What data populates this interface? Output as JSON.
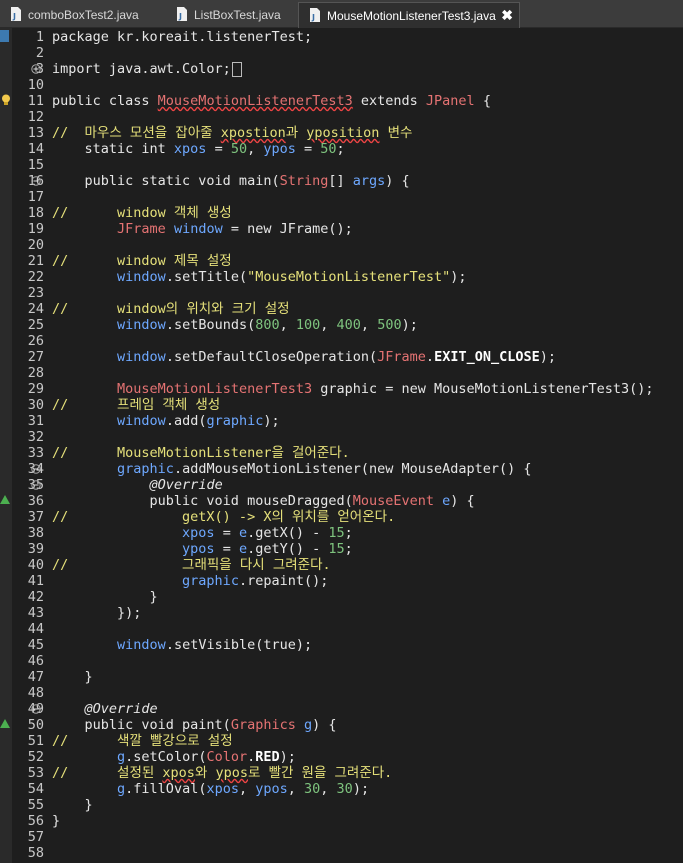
{
  "tabs": [
    {
      "label": "comboBoxTest2.java",
      "active": false
    },
    {
      "label": "ListBoxTest.java",
      "active": false
    },
    {
      "label": "MouseMotionListenerTest3.java",
      "active": true,
      "close": "✖"
    }
  ],
  "line_numbers": [
    "1",
    "2",
    "3",
    "10",
    "11",
    "12",
    "13",
    "14",
    "15",
    "16",
    "17",
    "18",
    "19",
    "20",
    "21",
    "22",
    "23",
    "24",
    "25",
    "26",
    "27",
    "28",
    "29",
    "30",
    "31",
    "32",
    "33",
    "34",
    "35",
    "36",
    "37",
    "38",
    "39",
    "40",
    "41",
    "42",
    "43",
    "44",
    "45",
    "46",
    "47",
    "48",
    "49",
    "50",
    "51",
    "52",
    "53",
    "54",
    "55",
    "56",
    "57",
    "58"
  ],
  "code": {
    "l1": {
      "a": "package kr.koreait.listenerTest;"
    },
    "l3": {
      "a": "import java.awt.Color;"
    },
    "l11": {
      "a": "public class ",
      "b": "MouseMotionListenerTest3",
      "c": " extends ",
      "d": "JPanel",
      "e": " {"
    },
    "l13": {
      "a": "//  마우스 모션을 잡아줄 ",
      "b": "xpostion",
      "c": "과 ",
      "d": "yposition",
      "e": " 변수"
    },
    "l14": {
      "a": "    static int ",
      "b": "xpos",
      "c": " = ",
      "d": "50",
      "e": ", ",
      "f": "ypos",
      "g": " = ",
      "h": "50",
      "i": ";"
    },
    "l16": {
      "a": "    public static void main(",
      "b": "String",
      "c": "[] ",
      "d": "args",
      "e": ") {"
    },
    "l18": {
      "a": "//      window 객체 생성"
    },
    "l19": {
      "a": "        ",
      "b": "JFrame",
      "c": " ",
      "d": "window",
      "e": " = new JFrame();"
    },
    "l21": {
      "a": "//      window 제목 설정"
    },
    "l22": {
      "a": "        ",
      "b": "window",
      "c": ".setTitle(",
      "d": "\"MouseMotionListenerTest\"",
      "e": ");"
    },
    "l24": {
      "a": "//      window의 위치와 크기 설정"
    },
    "l25": {
      "a": "        ",
      "b": "window",
      "c": ".setBounds(",
      "d": "800",
      "e": ", ",
      "f": "100",
      "g": ", ",
      "h": "400",
      "i": ", ",
      "j": "500",
      "k": ");"
    },
    "l27": {
      "a": "        ",
      "b": "window",
      "c": ".setDefaultCloseOperation(",
      "d": "JFrame",
      "e": ".",
      "f": "EXIT_ON_CLOSE",
      "g": ");"
    },
    "l29": {
      "a": "        ",
      "b": "MouseMotionListenerTest3",
      "c": " graphic = new MouseMotionListenerTest3();"
    },
    "l30": {
      "a": "//      프레임 객체 생성"
    },
    "l31": {
      "a": "        ",
      "b": "window",
      "c": ".add(",
      "d": "graphic",
      "e": ");"
    },
    "l33": {
      "a": "//      MouseMotionListener을 걸어준다."
    },
    "l34": {
      "a": "        ",
      "b": "graphic",
      "c": ".addMouseMotionListener(new MouseAdapter() {"
    },
    "l35": {
      "a": "            ",
      "b": "@Override"
    },
    "l36": {
      "a": "            public void mouseDragged(",
      "b": "MouseEvent",
      "c": " ",
      "d": "e",
      "e": ") {"
    },
    "l37": {
      "a": "//              getX() -> X의 위치를 얻어온다."
    },
    "l38": {
      "a": "                ",
      "b": "xpos",
      "c": " = ",
      "d": "e",
      "e": ".getX() - ",
      "f": "15",
      "g": ";"
    },
    "l39": {
      "a": "                ",
      "b": "ypos",
      "c": " = ",
      "d": "e",
      "e": ".getY() - ",
      "f": "15",
      "g": ";"
    },
    "l40": {
      "a": "//              그래픽을 다시 그려준다."
    },
    "l41": {
      "a": "                ",
      "b": "graphic",
      "c": ".repaint();"
    },
    "l42": {
      "a": "            }"
    },
    "l43": {
      "a": "        });"
    },
    "l45": {
      "a": "        ",
      "b": "window",
      "c": ".setVisible(true);"
    },
    "l47": {
      "a": "    }"
    },
    "l49": {
      "a": "    ",
      "b": "@Override"
    },
    "l50": {
      "a": "    public void paint(",
      "b": "Graphics",
      "c": " ",
      "d": "g",
      "e": ") {"
    },
    "l51": {
      "a": "//      색깔 빨강으로 설정"
    },
    "l52": {
      "a": "        ",
      "b": "g",
      "c": ".setColor(",
      "d": "Color",
      "e": ".",
      "f": "RED",
      "g": ");"
    },
    "l53": {
      "a": "//      설정된 ",
      "b": "xpos",
      "c": "와 ",
      "d": "ypos",
      "e": "로 빨간 원을 그려준다."
    },
    "l54": {
      "a": "        ",
      "b": "g",
      "c": ".fillOval(",
      "d": "xpos",
      "e": ", ",
      "f": "ypos",
      "g": ", ",
      "h": "30",
      "i": ", ",
      "j": "30",
      "k": ");"
    },
    "l55": {
      "a": "    }"
    },
    "l56": {
      "a": "}"
    }
  },
  "icons": {
    "tab_file": "java-file-icon",
    "fold_collapsed": "fold-plus-icon",
    "fold_expanded": "fold-minus-icon",
    "override": "override-triangle-icon",
    "warning": "lightbulb-icon"
  },
  "colors": {
    "background": "#1e1e1e",
    "keyword": "#e6e6e6",
    "type": "#e57373",
    "comment": "#e5e07a",
    "field": "#6ea8ff",
    "number": "#7ec37e"
  }
}
